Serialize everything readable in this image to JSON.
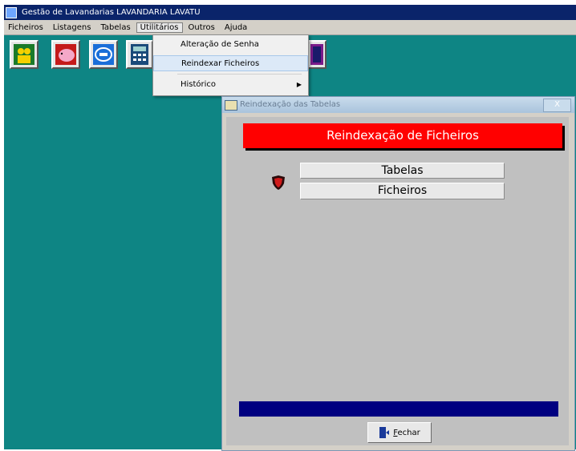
{
  "window": {
    "title": "Gestão de Lavandarias  LAVANDARIA LAVATU"
  },
  "menubar": {
    "items": [
      "Ficheiros",
      "Listagens",
      "Tabelas",
      "Utilitários",
      "Outros",
      "Ajuda"
    ],
    "active_index": 3
  },
  "dropdown": {
    "items": [
      {
        "label": "Alteração de Senha"
      },
      {
        "label": "Reindexar Ficheiros"
      },
      {
        "label": "Histórico"
      }
    ],
    "highlighted_index": 1
  },
  "dialog": {
    "title": "Reindexação das Tabelas",
    "close_label": "X",
    "banner": "Reindexação de Ficheiros",
    "buttons": {
      "tabelas": "Tabelas",
      "ficheiros": "Ficheiros"
    },
    "close_button": "Fechar",
    "progress_fraction": 1.0
  },
  "colors": {
    "titlebar": "#0a246a",
    "desktop": "#0e8584",
    "banner": "#ff0000",
    "progress": "#000080"
  },
  "icons": [
    "people-icon",
    "piggy-bank-icon",
    "logo-icon",
    "calculator-icon",
    "book-icon",
    "shield-icon",
    "exit-door-icon"
  ]
}
